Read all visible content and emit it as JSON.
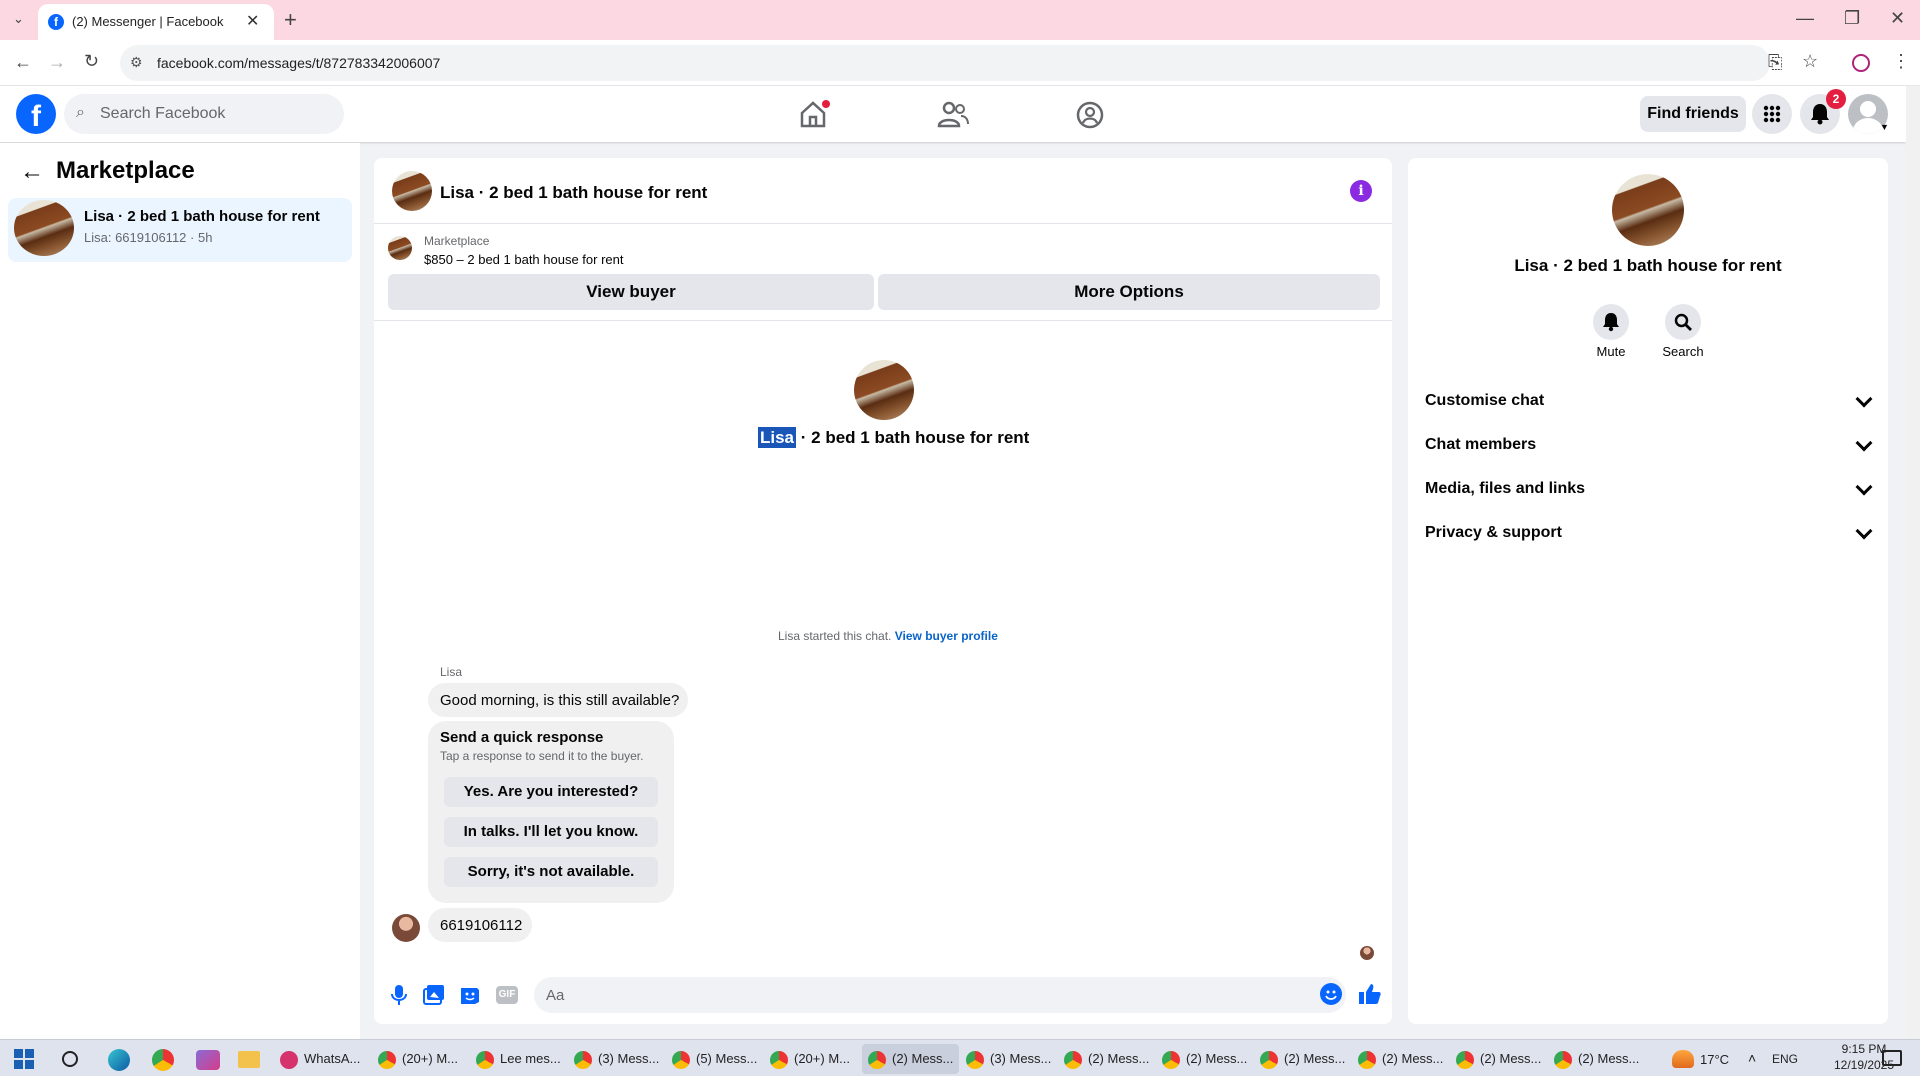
{
  "browser": {
    "tab_title": "(2) Messenger | Facebook",
    "url": "facebook.com/messages/t/872783342006007"
  },
  "fbnav": {
    "search_placeholder": "Search Facebook",
    "find_friends": "Find friends",
    "notif_count": "2"
  },
  "left": {
    "title": "Marketplace",
    "conversation": {
      "title": "Lisa · 2 bed 1 bath house for rent",
      "subtitle": "Lisa: 6619106112 · 5h"
    }
  },
  "chat": {
    "header_title": "Lisa · 2 bed 1 bath house for rent",
    "listing_source": "Marketplace",
    "listing_text": "$850 – 2 bed 1 bath house for rent",
    "view_buyer": "View buyer",
    "more_options": "More Options",
    "center_name_highlight": "Lisa",
    "center_title_rest": " · 2 bed 1 bath house for rent",
    "started_text": "Lisa started this chat.",
    "view_buyer_profile": "View buyer profile",
    "sender": "Lisa",
    "message1": "Good morning, is this still available?",
    "quick_title": "Send a quick response",
    "quick_sub": "Tap a response to send it to the buyer.",
    "quick_responses": [
      "Yes. Are you interested?",
      "In talks. I'll let you know.",
      "Sorry, it's not available."
    ],
    "message2": "6619106112",
    "input_placeholder": "Aa"
  },
  "right": {
    "title": "Lisa · 2 bed 1 bath house for rent",
    "mute": "Mute",
    "search": "Search",
    "sections": [
      "Customise chat",
      "Chat members",
      "Media, files and links",
      "Privacy & support"
    ]
  },
  "taskbar": {
    "items": [
      "WhatsA...",
      "(20+) M...",
      "Lee mes...",
      "(3) Mess...",
      "(5) Mess...",
      "(20+) M...",
      "(2) Mess...",
      "(3) Mess...",
      "(2) Mess...",
      "(2) Mess...",
      "(2) Mess...",
      "(2) Mess...",
      "(2) Mess...",
      "(2) Mess..."
    ],
    "weather": "17°C",
    "lang": "ENG",
    "time": "9:15 PM",
    "date": "12/19/2025"
  },
  "colors": {
    "fb_blue": "#0866ff",
    "tab_pink": "#fbd8e2",
    "link_blue": "#0a64c8"
  }
}
